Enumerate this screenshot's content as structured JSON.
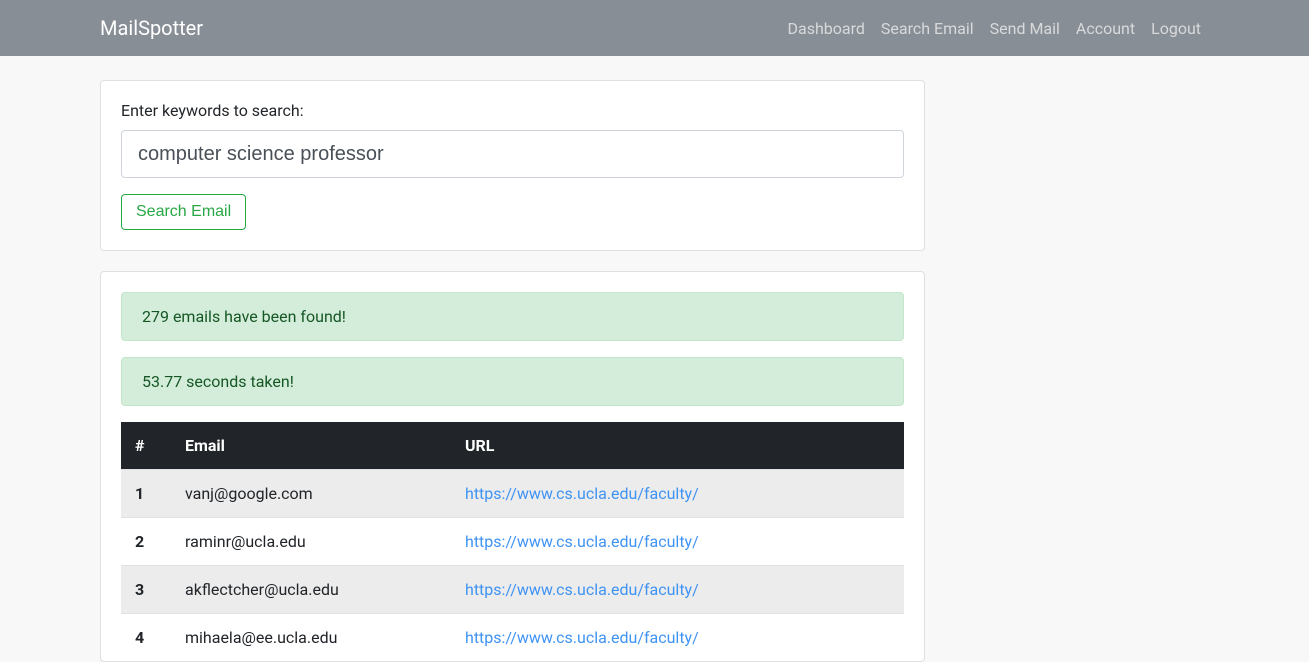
{
  "navbar": {
    "brand": "MailSpotter",
    "links": [
      "Dashboard",
      "Search Email",
      "Send Mail",
      "Account",
      "Logout"
    ]
  },
  "search": {
    "label": "Enter keywords to search:",
    "value": "computer science professor",
    "button": "Search Email"
  },
  "alerts": {
    "found": "279 emails have been found!",
    "time": "53.77 seconds taken!"
  },
  "table": {
    "headers": {
      "num": "#",
      "email": "Email",
      "url": "URL"
    },
    "rows": [
      {
        "num": "1",
        "email": "vanj@google.com",
        "url": "https://www.cs.ucla.edu/faculty/"
      },
      {
        "num": "2",
        "email": "raminr@ucla.edu",
        "url": "https://www.cs.ucla.edu/faculty/"
      },
      {
        "num": "3",
        "email": "akflectcher@ucla.edu",
        "url": "https://www.cs.ucla.edu/faculty/"
      },
      {
        "num": "4",
        "email": "mihaela@ee.ucla.edu",
        "url": "https://www.cs.ucla.edu/faculty/"
      }
    ]
  }
}
